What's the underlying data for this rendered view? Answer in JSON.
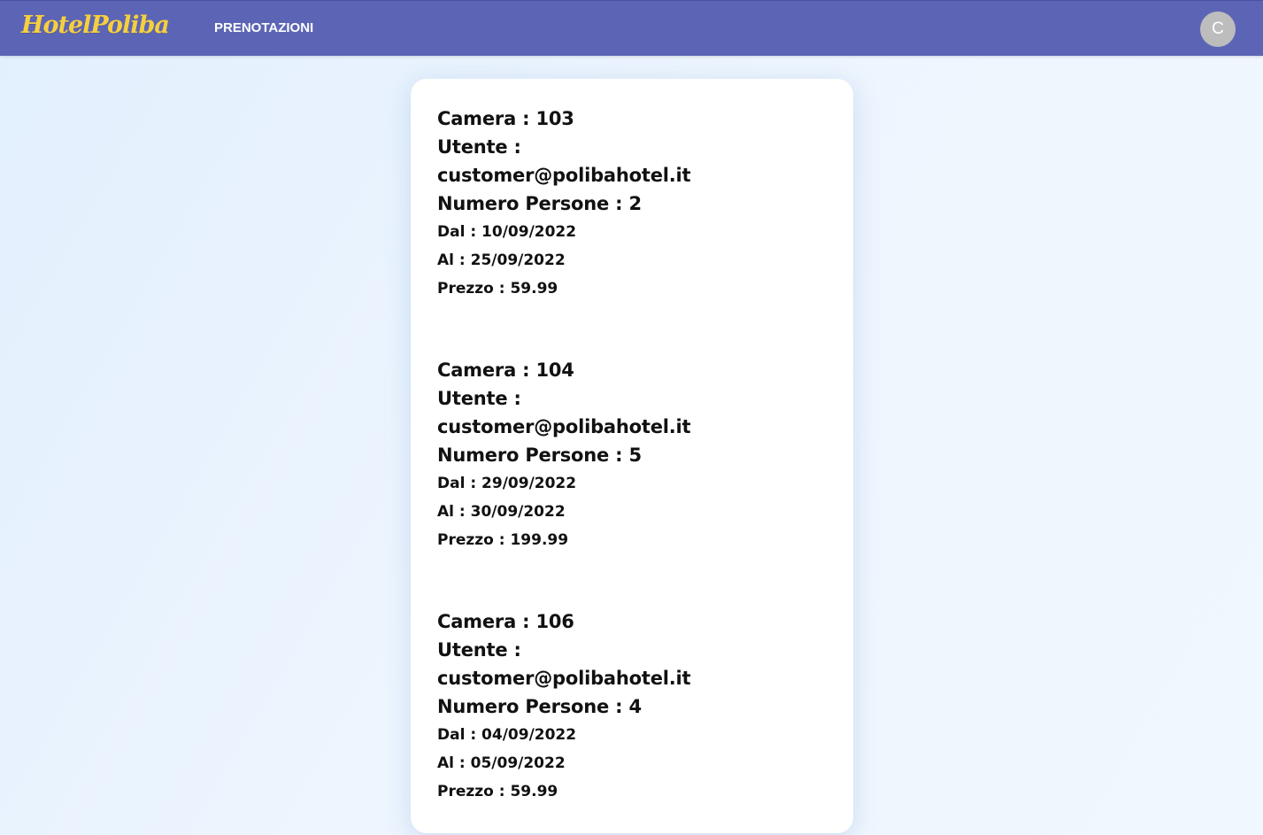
{
  "navbar": {
    "brand": "HotelPoliba",
    "link": "PRENOTAZIONI",
    "avatar_initial": "C"
  },
  "colors": {
    "navbar": "#5c65b5",
    "brand": "#f6cf3f",
    "avatar": "#bdbdbd",
    "card": "#ffffff"
  },
  "bookings": [
    {
      "camera": "Camera : 103",
      "utente_label": "Utente :",
      "utente": "customer@polibahotel.it",
      "persone": "Numero Persone : 2",
      "dal": "Dal : 10/09/2022",
      "al": "Al : 25/09/2022",
      "prezzo": "Prezzo : 59.99"
    },
    {
      "camera": "Camera : 104",
      "utente_label": "Utente :",
      "utente": "customer@polibahotel.it",
      "persone": "Numero Persone : 5",
      "dal": "Dal : 29/09/2022",
      "al": "Al : 30/09/2022",
      "prezzo": "Prezzo : 199.99"
    },
    {
      "camera": "Camera : 106",
      "utente_label": "Utente :",
      "utente": "customer@polibahotel.it",
      "persone": "Numero Persone : 4",
      "dal": "Dal : 04/09/2022",
      "al": "Al : 05/09/2022",
      "prezzo": "Prezzo : 59.99"
    }
  ]
}
